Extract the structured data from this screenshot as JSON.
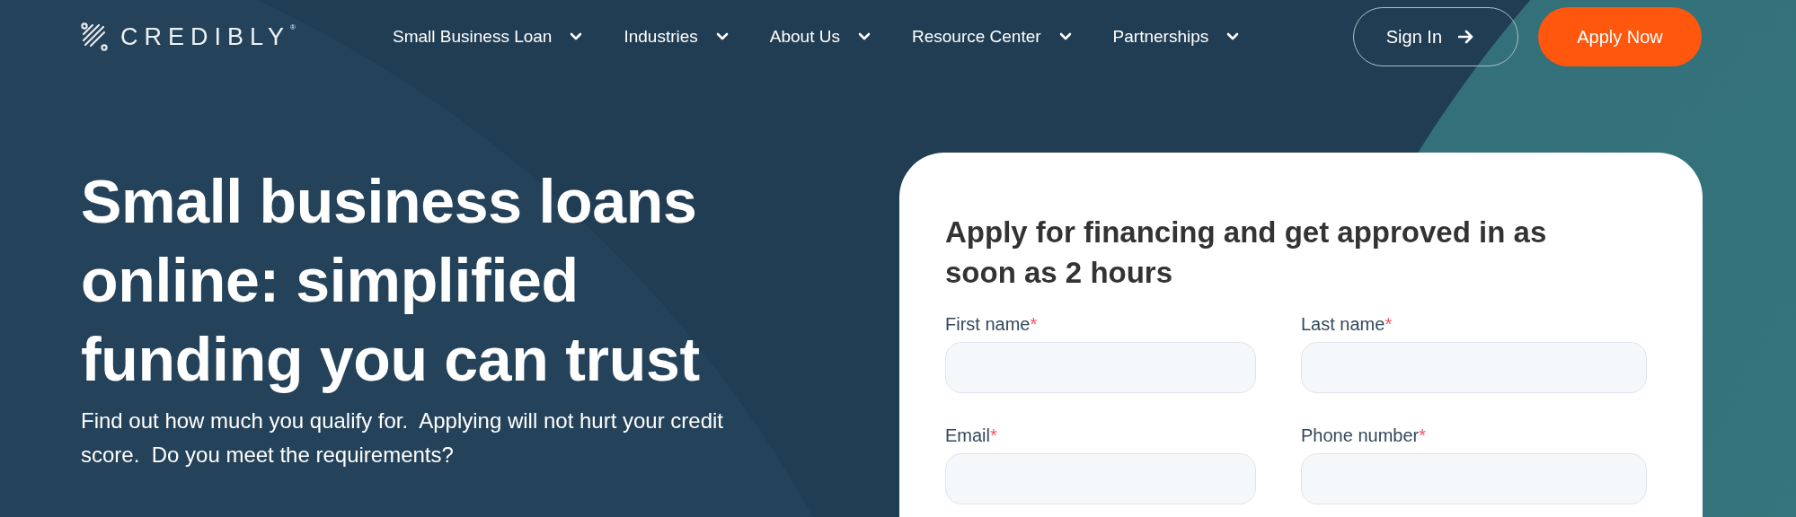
{
  "header": {
    "logo_text": "CREDIBLY",
    "logo_mark": "®",
    "nav": [
      {
        "label": "Small Business Loan"
      },
      {
        "label": "Industries"
      },
      {
        "label": "About Us"
      },
      {
        "label": "Resource Center"
      },
      {
        "label": "Partnerships"
      }
    ],
    "sign_in": "Sign In",
    "apply": "Apply Now"
  },
  "hero": {
    "heading": "Small business loans online: simplified funding you can trust",
    "text": "Find out how much you qualify for.  Applying will not hurt your credit score.  Do you meet the requirements?"
  },
  "form": {
    "title": "Apply for financing and get approved in as soon as 2 hours",
    "fields": [
      {
        "label": "First name",
        "required_mark": "*"
      },
      {
        "label": "Last name",
        "required_mark": "*"
      },
      {
        "label": "Email",
        "required_mark": "*"
      },
      {
        "label": "Phone number",
        "required_mark": "*"
      }
    ]
  }
}
